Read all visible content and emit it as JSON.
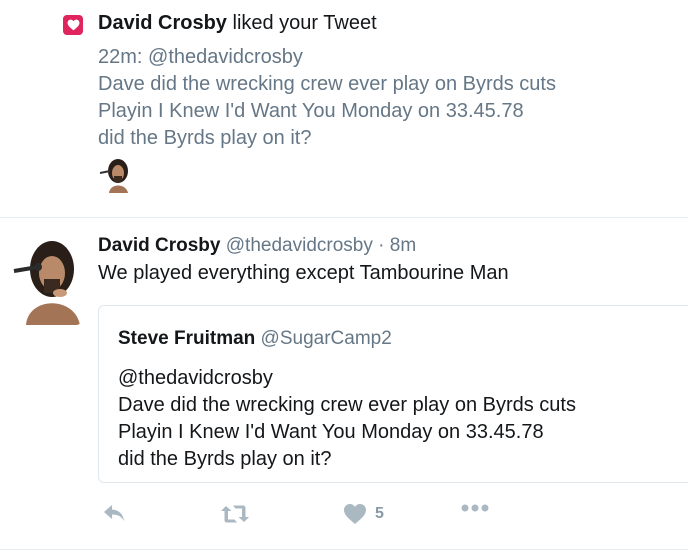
{
  "notification": {
    "icon": "heart-icon",
    "accent": "#e0245e",
    "liker_name": "David Crosby",
    "action_text": " liked your Tweet",
    "tweet_meta": "22m: @thedavidcrosby",
    "tweet_lines": [
      "Dave did the wrecking crew ever play on Byrds cuts",
      "Playin I Knew I'd Want You Monday on 33.45.78",
      "did the Byrds play on it?"
    ]
  },
  "reply_tweet": {
    "name": "David Crosby",
    "handle": "@thedavidcrosby",
    "separator": "·",
    "time": "8m",
    "text": "We played everything except Tambourine Man",
    "quoted": {
      "name": "Steve Fruitman",
      "handle": "@SugarCamp2",
      "lines": [
        "@thedavidcrosby",
        "Dave did the wrecking crew ever play on Byrds cuts",
        "Playin I Knew I'd Want You Monday on 33.45.78",
        "did the Byrds play on it?"
      ]
    },
    "actions": {
      "reply_icon": "reply-icon",
      "retweet_icon": "retweet-icon",
      "like_icon": "heart-icon",
      "like_count": "5",
      "more_icon": "more-icon"
    }
  }
}
